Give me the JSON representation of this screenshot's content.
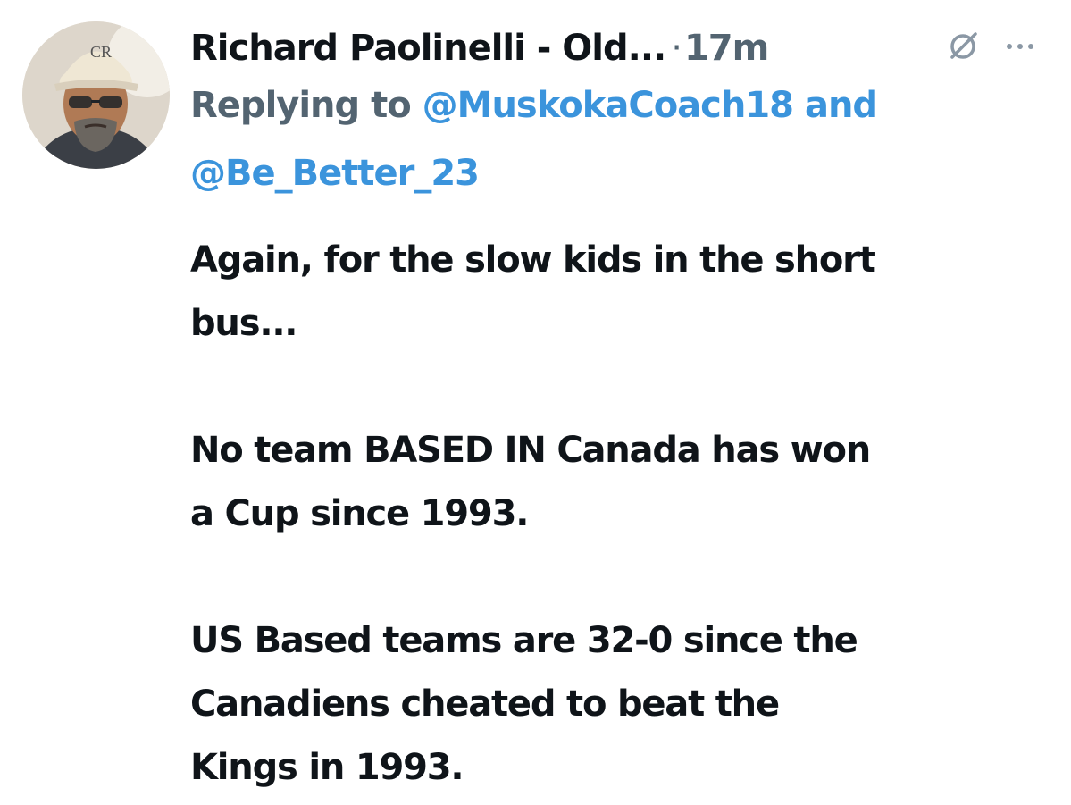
{
  "tweet": {
    "author_name": "Richard Paolinelli - Old...",
    "separator": "·",
    "timestamp": "17m",
    "reply_prefix": "Replying to",
    "mention_1": "@MuskokaCoach18",
    "reply_join": "and",
    "mention_2": "@Be_Better_23",
    "paragraphs": [
      {
        "line1": "Again, for the slow kids in the short",
        "line2": "bus..."
      },
      {
        "line1": "No team BASED IN Canada has won",
        "line2": "a Cup since 1993."
      },
      {
        "line1": "US Based teams are 32-0 since the",
        "line2": "Canadiens cheated to beat the",
        "line3": "Kings in 1993."
      }
    ]
  },
  "icons": {
    "avatar": "profile-photo",
    "grok": "grok-icon",
    "more": "more-options-icon"
  },
  "colors": {
    "text": "#0f1419",
    "secondary": "#536471",
    "link": "#3b94dc"
  }
}
